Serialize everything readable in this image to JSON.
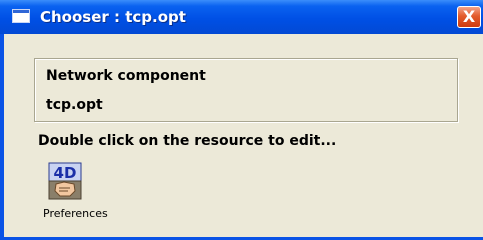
{
  "window": {
    "title": "Chooser : tcp.opt",
    "close_symbol": "X"
  },
  "group": {
    "title": "Network component",
    "value": "tcp.opt"
  },
  "instruction": "Double click on the resource to edit...",
  "resources": [
    {
      "label": "Preferences",
      "icon": "4d-preferences-icon",
      "icon_text": "4D"
    }
  ],
  "colors": {
    "titlebar": "#0050e5",
    "window_bg": "#ece9d8",
    "close_button": "#e35b2c"
  }
}
